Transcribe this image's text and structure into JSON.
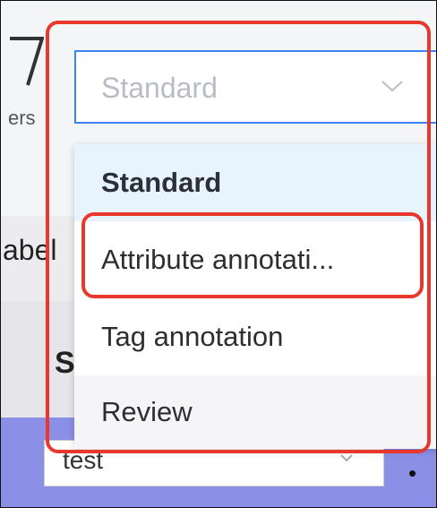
{
  "background": {
    "filters_fragment": "ers",
    "label_fragment": "abel",
    "section_fragment": "S",
    "bottom_select_value": "test"
  },
  "select": {
    "value": "Standard"
  },
  "menu": {
    "items": [
      {
        "label": "Standard"
      },
      {
        "label": "Attribute annotati..."
      },
      {
        "label": "Tag annotation"
      },
      {
        "label": "Review"
      }
    ]
  },
  "colors": {
    "highlight": "#e8372c",
    "focus_border": "#3b82f6",
    "selected_item_bg": "#e8f4fd",
    "footer_bar": "#8b8fe6"
  },
  "icons": {
    "filter": "funnel-icon",
    "select_caret": "chevron-down-icon"
  }
}
